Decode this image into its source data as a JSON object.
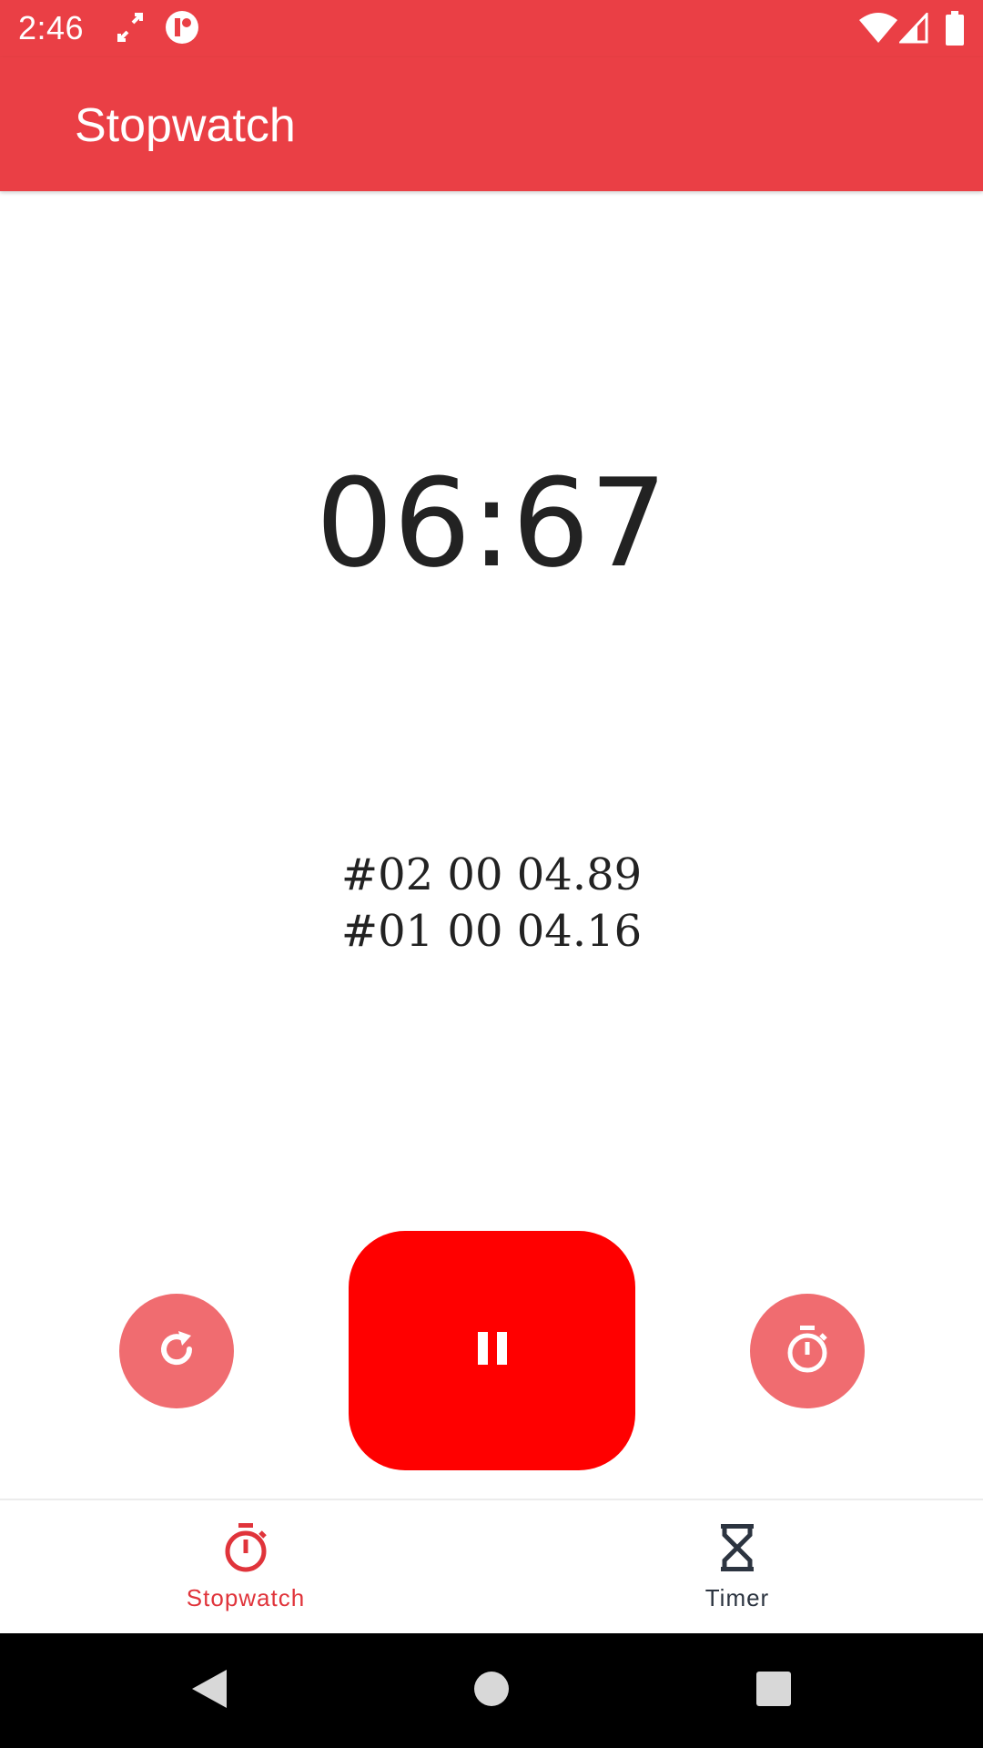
{
  "status_bar": {
    "time": "2:46",
    "icons": [
      "sync-arrows-icon",
      "app-notification-icon",
      "wifi-icon",
      "cell-signal-icon",
      "battery-icon"
    ]
  },
  "app_bar": {
    "title": "Stopwatch"
  },
  "stopwatch": {
    "elapsed": "06:67",
    "laps": [
      {
        "label": "#02 00 04.89"
      },
      {
        "label": "#01 00 04.16"
      }
    ]
  },
  "controls": {
    "reset_icon": "refresh-icon",
    "pause_icon": "pause-icon",
    "lap_icon": "stopwatch-icon"
  },
  "bottom_nav": {
    "items": [
      {
        "label": "Stopwatch",
        "icon": "stopwatch-icon",
        "selected": true
      },
      {
        "label": "Timer",
        "icon": "hourglass-icon",
        "selected": false
      }
    ]
  },
  "colors": {
    "app_bar": "#EA3F45",
    "primary_button": "#FF0000",
    "secondary_button": "#F06C70",
    "nav_selected": "#E0343B",
    "nav_unselected": "#2c3440"
  }
}
